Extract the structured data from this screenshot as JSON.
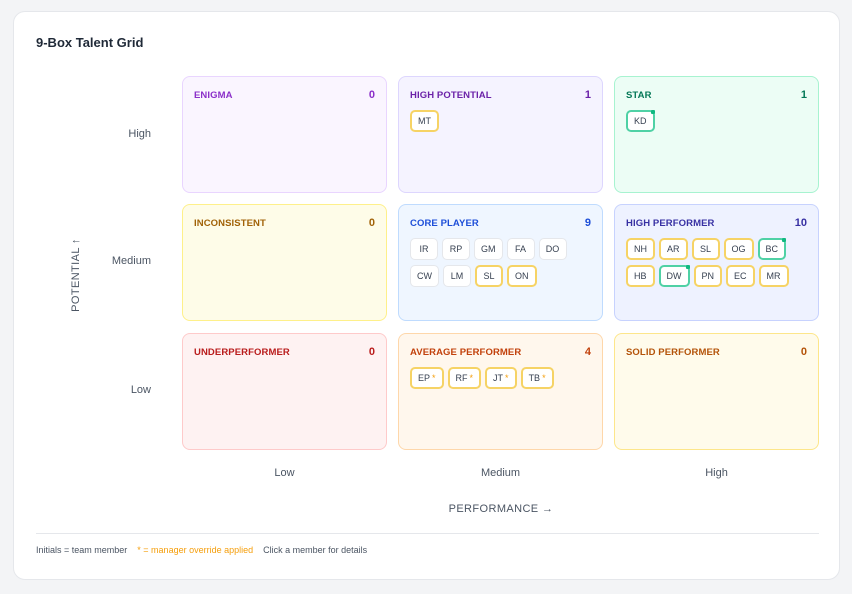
{
  "title": "9-Box Talent Grid",
  "axes": {
    "y_label": "POTENTIAL ↑",
    "x_label": "PERFORMANCE →",
    "rows": [
      "High",
      "Medium",
      "Low"
    ],
    "cols": [
      "Low",
      "Medium",
      "High"
    ]
  },
  "boxes": [
    {
      "id": "enigma",
      "name": "ENIGMA",
      "count": "0",
      "color": "#8b2fc9",
      "bg": "#faf5ff",
      "border": "#e9d5ff",
      "members": []
    },
    {
      "id": "high-potential",
      "name": "HIGH POTENTIAL",
      "count": "1",
      "color": "#6b21a8",
      "bg": "#f5f3ff",
      "border": "#ddd6fe",
      "members": [
        {
          "initials": "MT",
          "status": "y",
          "override": false
        }
      ]
    },
    {
      "id": "star",
      "name": "STAR",
      "count": "1",
      "color": "#047857",
      "bg": "#ecfdf5",
      "border": "#a7f3d0",
      "members": [
        {
          "initials": "KD",
          "status": "g",
          "override": false
        }
      ]
    },
    {
      "id": "inconsistent",
      "name": "INCONSISTENT",
      "count": "0",
      "color": "#a16207",
      "bg": "#fefce8",
      "border": "#fef08a",
      "members": []
    },
    {
      "id": "core-player",
      "name": "CORE PLAYER",
      "count": "9",
      "color": "#1d4ed8",
      "bg": "#eff6ff",
      "border": "#bfdbfe",
      "members": [
        {
          "initials": "IR",
          "status": "n",
          "override": false
        },
        {
          "initials": "RP",
          "status": "n",
          "override": false
        },
        {
          "initials": "GM",
          "status": "n",
          "override": false
        },
        {
          "initials": "FA",
          "status": "n",
          "override": false
        },
        {
          "initials": "DO",
          "status": "n",
          "override": false
        },
        {
          "initials": "CW",
          "status": "n",
          "override": false
        },
        {
          "initials": "LM",
          "status": "n",
          "override": false
        },
        {
          "initials": "SL",
          "status": "y",
          "override": false
        },
        {
          "initials": "ON",
          "status": "y",
          "override": false
        }
      ]
    },
    {
      "id": "high-performer",
      "name": "HIGH PERFORMER",
      "count": "10",
      "color": "#3730a3",
      "bg": "#eef2ff",
      "border": "#c7d2fe",
      "members": [
        {
          "initials": "NH",
          "status": "y",
          "override": false
        },
        {
          "initials": "AR",
          "status": "y",
          "override": false
        },
        {
          "initials": "SL",
          "status": "y",
          "override": false
        },
        {
          "initials": "OG",
          "status": "y",
          "override": false
        },
        {
          "initials": "BC",
          "status": "g",
          "override": false
        },
        {
          "initials": "HB",
          "status": "y",
          "override": false
        },
        {
          "initials": "DW",
          "status": "g",
          "override": false
        },
        {
          "initials": "PN",
          "status": "y",
          "override": false
        },
        {
          "initials": "EC",
          "status": "y",
          "override": false
        },
        {
          "initials": "MR",
          "status": "y",
          "override": false
        }
      ]
    },
    {
      "id": "underperformer",
      "name": "UNDERPERFORMER",
      "count": "0",
      "color": "#b91c1c",
      "bg": "#fef2f2",
      "border": "#fecaca",
      "members": []
    },
    {
      "id": "average-performer",
      "name": "AVERAGE PERFORMER",
      "count": "4",
      "color": "#c2410c",
      "bg": "#fff7ed",
      "border": "#fed7aa",
      "members": [
        {
          "initials": "EP",
          "status": "y",
          "override": true
        },
        {
          "initials": "RF",
          "status": "y",
          "override": true
        },
        {
          "initials": "JT",
          "status": "y",
          "override": true
        },
        {
          "initials": "TB",
          "status": "y",
          "override": true
        }
      ]
    },
    {
      "id": "solid-performer",
      "name": "SOLID PERFORMER",
      "count": "0",
      "color": "#b45309",
      "bg": "#fffbeb",
      "border": "#fde68a",
      "members": []
    }
  ],
  "legend": {
    "member": "Initials = team member",
    "override": "* = manager override applied",
    "details": "Click a member for details",
    "star_symbol": "*"
  }
}
